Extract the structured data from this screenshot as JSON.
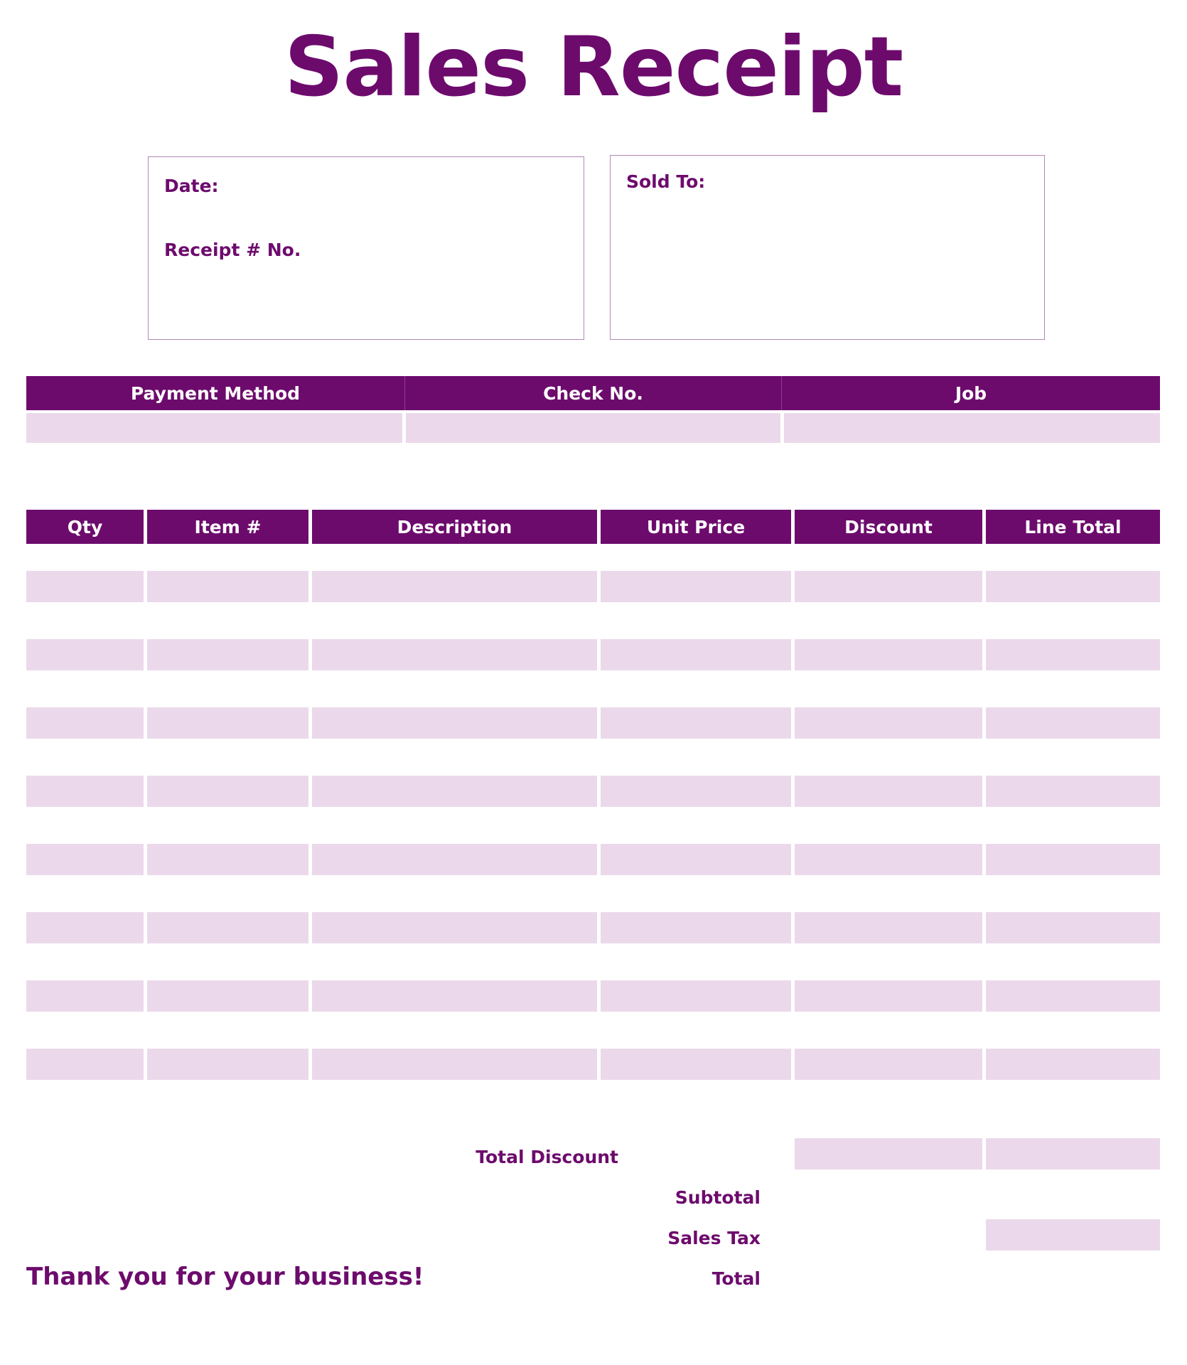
{
  "document": {
    "title": "Sales Receipt"
  },
  "colors": {
    "header_purple": "#6d0b6d",
    "cell_lavender": "#ebd9eb",
    "box_border": "#b487b4",
    "text_purple": "#6d0b6d"
  },
  "info": {
    "date_label": "Date:",
    "receipt_no_label": "Receipt # No.",
    "sold_to_label": "Sold To:"
  },
  "payment": {
    "headers": [
      "Payment Method",
      "Check No.",
      "Job"
    ],
    "values": [
      "",
      "",
      ""
    ]
  },
  "items": {
    "headers": [
      "Qty",
      "Item #",
      "Description",
      "Unit Price",
      "Discount",
      "Line Total"
    ],
    "rows": [
      {
        "qty": "",
        "item": "",
        "description": "",
        "unit_price": "",
        "discount": "",
        "line_total": ""
      },
      {
        "qty": "",
        "item": "",
        "description": "",
        "unit_price": "",
        "discount": "",
        "line_total": ""
      },
      {
        "qty": "",
        "item": "",
        "description": "",
        "unit_price": "",
        "discount": "",
        "line_total": ""
      },
      {
        "qty": "",
        "item": "",
        "description": "",
        "unit_price": "",
        "discount": "",
        "line_total": ""
      },
      {
        "qty": "",
        "item": "",
        "description": "",
        "unit_price": "",
        "discount": "",
        "line_total": ""
      },
      {
        "qty": "",
        "item": "",
        "description": "",
        "unit_price": "",
        "discount": "",
        "line_total": ""
      },
      {
        "qty": "",
        "item": "",
        "description": "",
        "unit_price": "",
        "discount": "",
        "line_total": ""
      },
      {
        "qty": "",
        "item": "",
        "description": "",
        "unit_price": "",
        "discount": "",
        "line_total": ""
      }
    ]
  },
  "totals": {
    "total_discount_label": "Total Discount",
    "total_discount_value_1": "",
    "total_discount_value_2": "",
    "subtotal_label": "Subtotal",
    "subtotal_value": "",
    "sales_tax_label": "Sales Tax",
    "sales_tax_value": "",
    "total_label": "Total",
    "total_value": ""
  },
  "footer": {
    "thank_you": "Thank you for your business!"
  }
}
